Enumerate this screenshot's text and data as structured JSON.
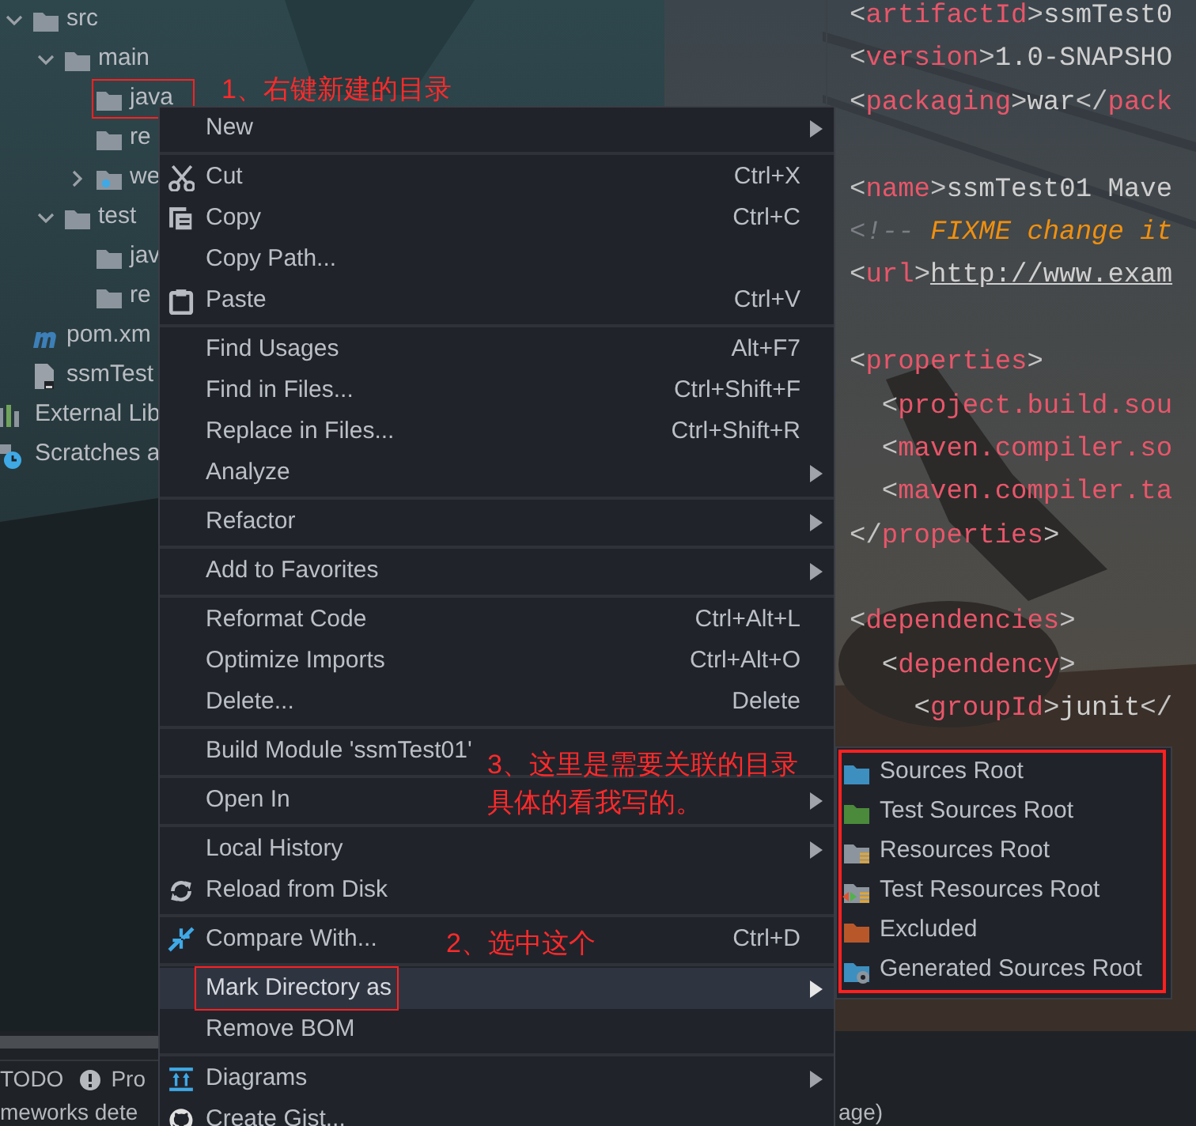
{
  "project_tree": {
    "module_items": [
      {
        "label": "src",
        "kind": "folder",
        "expanded": true,
        "children": [
          {
            "label": "main",
            "kind": "folder",
            "expanded": true,
            "children": [
              {
                "label": "java",
                "kind": "folder"
              },
              {
                "label": "re",
                "kind": "folder"
              },
              {
                "label": "we",
                "kind": "web_folder",
                "expanded": false
              }
            ]
          },
          {
            "label": "test",
            "kind": "folder",
            "expanded": true,
            "children": [
              {
                "label": "jav",
                "kind": "folder"
              },
              {
                "label": "re",
                "kind": "folder"
              }
            ]
          }
        ]
      },
      {
        "label": "pom.xm",
        "kind": "maven"
      },
      {
        "label": "ssmTest",
        "kind": "file"
      }
    ],
    "root_items": [
      {
        "label": "External Lib",
        "kind": "library"
      },
      {
        "label": "Scratches a",
        "kind": "scratches"
      }
    ]
  },
  "editor": {
    "lines": [
      {
        "after_blank": false,
        "segments": [
          {
            "kind": "punct",
            "text": "<"
          },
          {
            "kind": "tag",
            "text": "artifactId"
          },
          {
            "kind": "punct",
            "text": ">"
          },
          {
            "kind": "text",
            "text": "ssmTest0"
          }
        ]
      },
      {
        "after_blank": false,
        "segments": [
          {
            "kind": "punct",
            "text": "<"
          },
          {
            "kind": "tag",
            "text": "version"
          },
          {
            "kind": "punct",
            "text": ">"
          },
          {
            "kind": "text",
            "text": "1.0-SNAPSHO"
          }
        ]
      },
      {
        "after_blank": false,
        "segments": [
          {
            "kind": "punct",
            "text": "<"
          },
          {
            "kind": "tag",
            "text": "packaging"
          },
          {
            "kind": "punct",
            "text": ">"
          },
          {
            "kind": "text",
            "text": "war"
          },
          {
            "kind": "punct",
            "text": "</"
          },
          {
            "kind": "tag",
            "text": "pack"
          }
        ]
      },
      {
        "after_blank": true,
        "segments": [
          {
            "kind": "punct",
            "text": "<"
          },
          {
            "kind": "tag",
            "text": "name"
          },
          {
            "kind": "punct",
            "text": ">"
          },
          {
            "kind": "text",
            "text": "ssmTest01 Mave"
          }
        ]
      },
      {
        "after_blank": false,
        "segments": [
          {
            "kind": "comment_mark",
            "text": "<!-- "
          },
          {
            "kind": "comment",
            "text": "FIXME change it"
          }
        ]
      },
      {
        "after_blank": false,
        "segments": [
          {
            "kind": "punct",
            "text": "<"
          },
          {
            "kind": "tag",
            "text": "url"
          },
          {
            "kind": "punct",
            "text": ">"
          },
          {
            "kind": "link",
            "text": "http://www.exam"
          }
        ]
      },
      {
        "after_blank": true,
        "segments": [
          {
            "kind": "punct",
            "text": "<"
          },
          {
            "kind": "tag",
            "text": "properties"
          },
          {
            "kind": "punct",
            "text": ">"
          }
        ]
      },
      {
        "after_blank": false,
        "segments": [
          {
            "kind": "punct",
            "text": "  <"
          },
          {
            "kind": "tag",
            "text": "project.build.sou"
          }
        ]
      },
      {
        "after_blank": false,
        "segments": [
          {
            "kind": "punct",
            "text": "  <"
          },
          {
            "kind": "tag",
            "text": "maven.compiler.so"
          }
        ]
      },
      {
        "after_blank": false,
        "segments": [
          {
            "kind": "punct",
            "text": "  <"
          },
          {
            "kind": "tag",
            "text": "maven.compiler.ta"
          }
        ]
      },
      {
        "after_blank": false,
        "segments": [
          {
            "kind": "punct",
            "text": "</"
          },
          {
            "kind": "tag",
            "text": "properties"
          },
          {
            "kind": "punct",
            "text": ">"
          }
        ]
      },
      {
        "after_blank": true,
        "segments": [
          {
            "kind": "punct",
            "text": "<"
          },
          {
            "kind": "tag",
            "text": "dependencies"
          },
          {
            "kind": "punct",
            "text": ">"
          }
        ]
      },
      {
        "after_blank": false,
        "segments": [
          {
            "kind": "punct",
            "text": "  <"
          },
          {
            "kind": "tag",
            "text": "dependency"
          },
          {
            "kind": "punct",
            "text": ">"
          }
        ]
      },
      {
        "after_blank": false,
        "segments": [
          {
            "kind": "punct",
            "text": "    <"
          },
          {
            "kind": "tag",
            "text": "groupId"
          },
          {
            "kind": "punct",
            "text": ">"
          },
          {
            "kind": "text",
            "text": "junit"
          },
          {
            "kind": "punct",
            "text": "</"
          }
        ]
      }
    ]
  },
  "bottom_bar": {
    "tabs": [
      {
        "label": "TODO",
        "kind": "plain"
      },
      {
        "label": "Pro",
        "kind": "warning"
      }
    ],
    "status_left": "meworks dete",
    "status_right": "age)"
  },
  "context_menu": {
    "groups": [
      [
        {
          "label": "New",
          "kind": "plain",
          "submenu": true,
          "selected": false
        }
      ],
      [
        {
          "label": "Cut",
          "kind": "cut",
          "shortcut": "Ctrl+X",
          "submenu": false,
          "selected": false
        },
        {
          "label": "Copy",
          "kind": "copy",
          "shortcut": "Ctrl+C",
          "submenu": false,
          "selected": false
        },
        {
          "label": "Copy Path...",
          "kind": "plain",
          "submenu": false,
          "selected": false
        },
        {
          "label": "Paste",
          "kind": "paste",
          "shortcut": "Ctrl+V",
          "submenu": false,
          "selected": false
        }
      ],
      [
        {
          "label": "Find Usages",
          "kind": "plain",
          "shortcut": "Alt+F7",
          "submenu": false,
          "selected": false
        },
        {
          "label": "Find in Files...",
          "kind": "plain",
          "shortcut": "Ctrl+Shift+F",
          "submenu": false,
          "selected": false
        },
        {
          "label": "Replace in Files...",
          "kind": "plain",
          "shortcut": "Ctrl+Shift+R",
          "submenu": false,
          "selected": false
        },
        {
          "label": "Analyze",
          "kind": "plain",
          "submenu": true,
          "selected": false
        }
      ],
      [
        {
          "label": "Refactor",
          "kind": "plain",
          "submenu": true,
          "selected": false
        }
      ],
      [
        {
          "label": "Add to Favorites",
          "kind": "plain",
          "submenu": true,
          "selected": false
        }
      ],
      [
        {
          "label": "Reformat Code",
          "kind": "plain",
          "shortcut": "Ctrl+Alt+L",
          "submenu": false,
          "selected": false
        },
        {
          "label": "Optimize Imports",
          "kind": "plain",
          "shortcut": "Ctrl+Alt+O",
          "submenu": false,
          "selected": false
        },
        {
          "label": "Delete...",
          "kind": "plain",
          "shortcut": "Delete",
          "submenu": false,
          "selected": false
        }
      ],
      [
        {
          "label": "Build Module 'ssmTest01'",
          "kind": "plain",
          "submenu": false,
          "selected": false
        }
      ],
      [
        {
          "label": "Open In",
          "kind": "plain",
          "submenu": true,
          "selected": false
        }
      ],
      [
        {
          "label": "Local History",
          "kind": "plain",
          "submenu": true,
          "selected": false
        },
        {
          "label": "Reload from Disk",
          "kind": "reload",
          "submenu": false,
          "selected": false
        }
      ],
      [
        {
          "label": "Compare With...",
          "kind": "compare",
          "shortcut": "Ctrl+D",
          "submenu": false,
          "selected": false
        }
      ],
      [
        {
          "label": "Mark Directory as",
          "kind": "plain",
          "submenu": true,
          "selected": true
        },
        {
          "label": "Remove BOM",
          "kind": "plain",
          "submenu": false,
          "selected": false
        }
      ],
      [
        {
          "label": "Diagrams",
          "kind": "diagram",
          "submenu": true,
          "selected": false
        },
        {
          "label": "Create Gist...",
          "kind": "github",
          "submenu": false,
          "selected": false
        }
      ]
    ]
  },
  "submenu": {
    "items": [
      {
        "label": "Sources Root",
        "kind": "sources"
      },
      {
        "label": "Test Sources Root",
        "kind": "test_sources"
      },
      {
        "label": "Resources Root",
        "kind": "resources"
      },
      {
        "label": "Test Resources Root",
        "kind": "test_resources"
      },
      {
        "label": "Excluded",
        "kind": "excluded"
      },
      {
        "label": "Generated Sources Root",
        "kind": "generated"
      }
    ]
  },
  "annotations": [
    {
      "text": "1、右键新建的目录"
    },
    {
      "text": "3、这里是需要关联的目录具体的看我写的。"
    },
    {
      "text": "2、选中这个"
    }
  ]
}
